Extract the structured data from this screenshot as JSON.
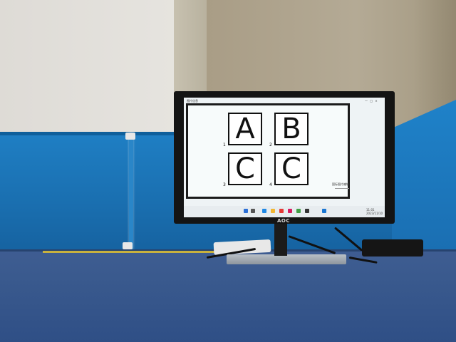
{
  "screen": {
    "window_title": "图片信息",
    "window_controls": "— □ ×",
    "cards": [
      {
        "letter": "A",
        "number": "1"
      },
      {
        "letter": "B",
        "number": "2"
      },
      {
        "letter": "C",
        "number": "3"
      },
      {
        "letter": "C",
        "number": "4"
      }
    ],
    "corner_logo": "国际图片编辑",
    "taskbar_time": "11:01",
    "taskbar_date": "2023/11/10"
  },
  "monitor": {
    "brand": "AOC"
  },
  "colors": {
    "partition_blue": "#1a6fb0",
    "floor_blue": "#3a5a8e",
    "bezel": "#141414",
    "screen_bg": "#eef3f5"
  },
  "icons": [
    "windows-start-icon",
    "search-icon",
    "taskview-icon",
    "explorer-icon",
    "browser-icon",
    "app-icon",
    "store-icon",
    "settings-icon"
  ]
}
